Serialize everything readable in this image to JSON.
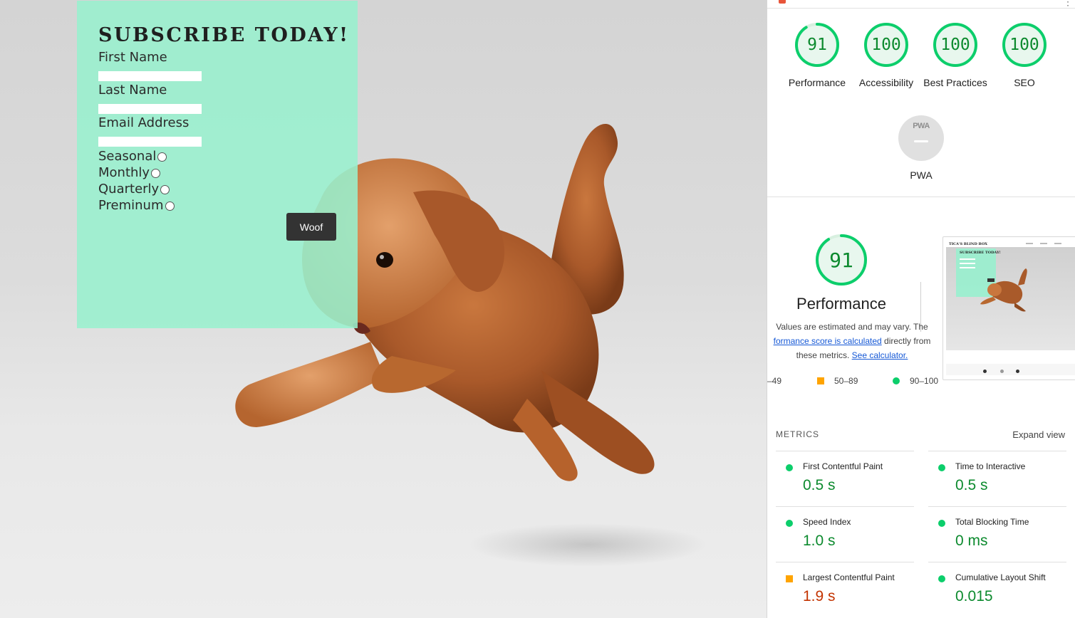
{
  "form": {
    "title": "SUBSCRIBE TODAY!",
    "first_name_label": "First Name",
    "last_name_label": "Last Name",
    "email_label": "Email Address",
    "plans": [
      "Seasonal",
      "Monthly",
      "Quarterly",
      "Preminum"
    ],
    "submit_label": "Woof"
  },
  "scores": [
    {
      "label": "Performance",
      "value": "91"
    },
    {
      "label": "Accessibility",
      "value": "100"
    },
    {
      "label": "Best Practices",
      "value": "100"
    },
    {
      "label": "SEO",
      "value": "100"
    }
  ],
  "pwa": {
    "label": "PWA",
    "mark": "PWA"
  },
  "performance": {
    "score": "91",
    "heading": "Performance",
    "desc_1": "Values are estimated and may vary. The",
    "desc_link": "formance score is calculated",
    "desc_2": " directly from",
    "desc_3": "these metrics. ",
    "calc_link": "See calculator.",
    "legend": [
      "–49",
      "50–89",
      "90–100"
    ]
  },
  "thumbnail": {
    "site_title": "TICA'S BLIND BOX",
    "form_title": "SUBSCRIBE TODAY!"
  },
  "metrics": {
    "heading": "METRICS",
    "expand": "Expand view",
    "items": [
      {
        "label": "First Contentful Paint",
        "value": "0.5 s",
        "rating": "pass"
      },
      {
        "label": "Time to Interactive",
        "value": "0.5 s",
        "rating": "pass"
      },
      {
        "label": "Speed Index",
        "value": "1.0 s",
        "rating": "pass"
      },
      {
        "label": "Total Blocking Time",
        "value": "0 ms",
        "rating": "pass"
      },
      {
        "label": "Largest Contentful Paint",
        "value": "1.9 s",
        "rating": "average"
      },
      {
        "label": "Cumulative Layout Shift",
        "value": "0.015",
        "rating": "pass"
      }
    ]
  },
  "colors": {
    "pass": "#0cce6b",
    "pass_text": "#0c8a2e",
    "average": "#ffa400",
    "fail_text": "#c33300",
    "form_bg": "#98f0ce"
  }
}
